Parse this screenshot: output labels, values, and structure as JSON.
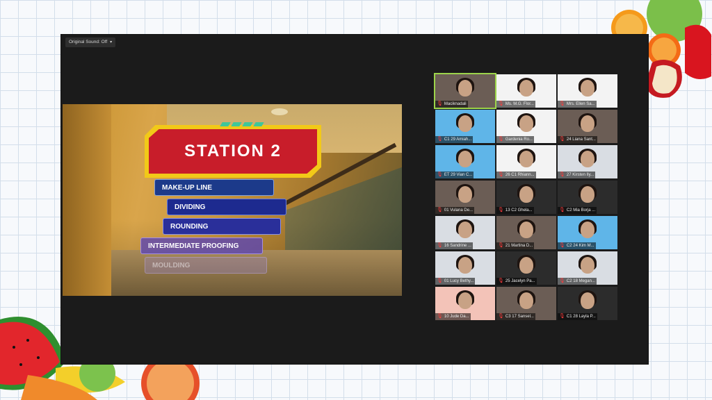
{
  "window": {
    "sound_toggle_label": "Original Sound: Off"
  },
  "slide": {
    "station_title": "STATION 2",
    "steps": [
      "MAKE-UP LINE",
      "DIVIDING",
      "ROUNDING",
      "INTERMEDIATE PROOFING",
      "MOULDING"
    ]
  },
  "participants": [
    {
      "name": "Maciknadali",
      "bg": "room",
      "active": true
    },
    {
      "name": "Ms. M.G. Flor...",
      "bg": "white"
    },
    {
      "name": "Mrs. Ellen Sa...",
      "bg": "white"
    },
    {
      "name": "C1 29 Amiah...",
      "bg": "blue"
    },
    {
      "name": "Gardenia Ro...",
      "bg": "white"
    },
    {
      "name": "24 Liana Sant...",
      "bg": "room"
    },
    {
      "name": "ET 29 Vian C...",
      "bg": "blue"
    },
    {
      "name": "26 C1 Rhiann...",
      "bg": "white"
    },
    {
      "name": "27 Kirsten Ily...",
      "bg": "light"
    },
    {
      "name": "01 Vulana De...",
      "bg": "room"
    },
    {
      "name": "13 C2 Ghela...",
      "bg": "dark"
    },
    {
      "name": "C2 Mia Borja ...",
      "bg": "dark"
    },
    {
      "name": "16 Sandrine ...",
      "bg": "light"
    },
    {
      "name": "21 Martina D...",
      "bg": "room"
    },
    {
      "name": "C2 24 Kim M...",
      "bg": "blue"
    },
    {
      "name": "01 Lucy Bethy...",
      "bg": "light"
    },
    {
      "name": "25 Jacelyn Pa...",
      "bg": "dark"
    },
    {
      "name": "C2 18 Megan...",
      "bg": "light"
    },
    {
      "name": "10 Jude Da...",
      "bg": "pink"
    },
    {
      "name": "C3 17 Sansel...",
      "bg": "room"
    },
    {
      "name": "C1 28 Layla P...",
      "bg": "dark"
    }
  ],
  "colors": {
    "active_speaker": "#9cd44a",
    "station_red": "#c81d2a",
    "station_yellow": "#f2c918"
  }
}
